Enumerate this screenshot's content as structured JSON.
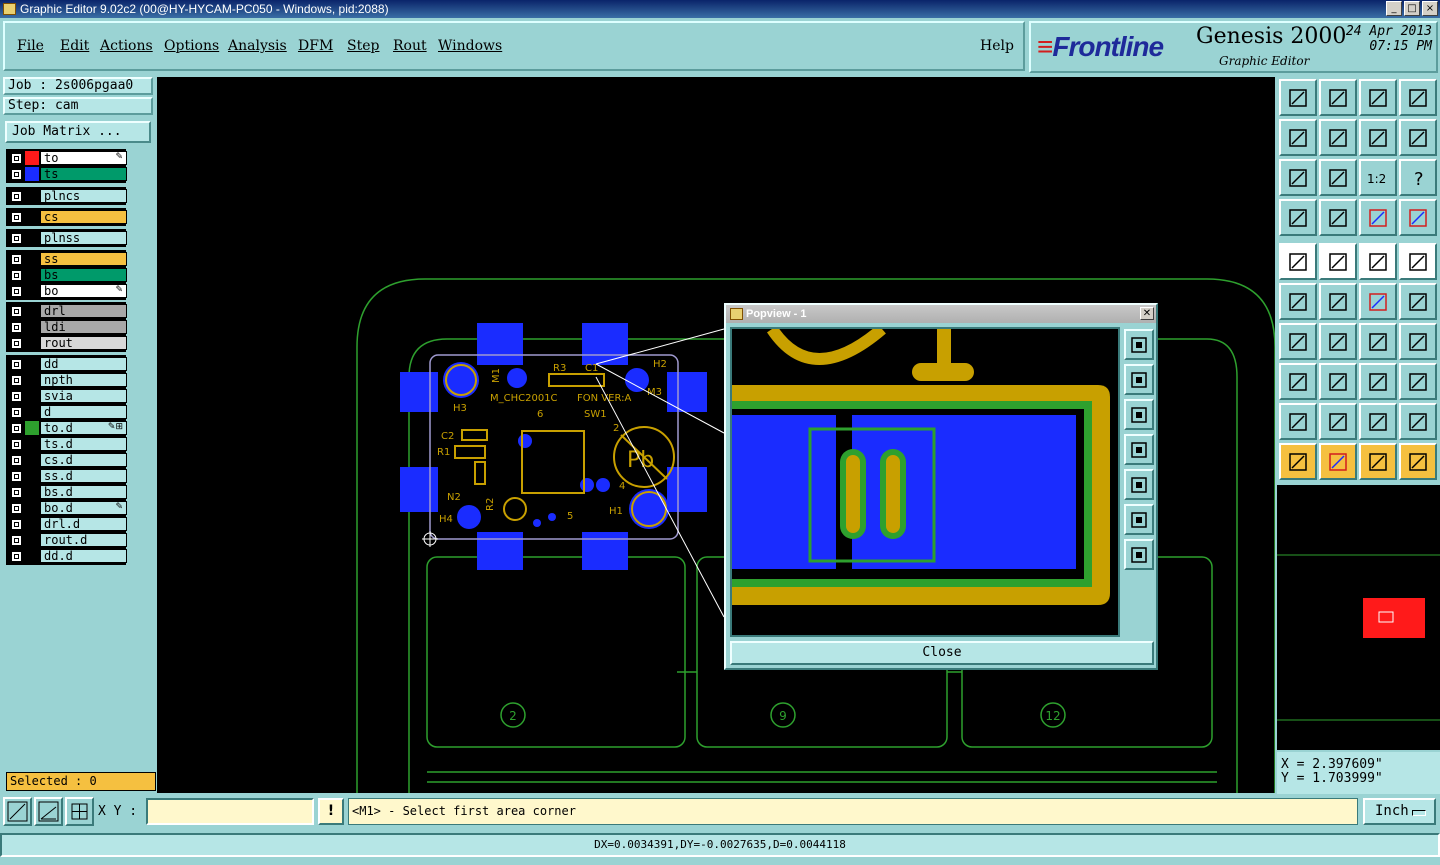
{
  "window": {
    "title": "Graphic Editor 9.02c2 (00@HY-HYCAM-PC050 - Windows, pid:2088)"
  },
  "menu": {
    "items": [
      "File",
      "Edit",
      "Actions",
      "Options",
      "Analysis",
      "DFM",
      "Step",
      "Rout",
      "Windows"
    ],
    "help": "Help"
  },
  "branding": {
    "logo": "Frontline",
    "product": "Genesis 2000",
    "subtitle": "Graphic Editor",
    "date": "24 Apr 2013",
    "time": "07:15 PM"
  },
  "job": {
    "job_label": "Job : 2s006pgaa0",
    "step_label": "Step: cam",
    "matrix_button": "Job Matrix ..."
  },
  "layers": [
    {
      "name": "to",
      "swatch": "#ff1a1a",
      "bg": "#ffffff",
      "icon": "✎"
    },
    {
      "name": "ts",
      "swatch": "#1a2cff",
      "bg": "#009a6a",
      "icon": ""
    },
    {
      "name": "plncs",
      "swatch": "#000000",
      "bg": "#b6e6e6",
      "icon": ""
    },
    {
      "name": "cs",
      "swatch": "#000000",
      "bg": "#f5c040",
      "icon": ""
    },
    {
      "name": "plnss",
      "swatch": "#000000",
      "bg": "#b6e6e6",
      "icon": ""
    },
    {
      "name": "ss",
      "swatch": "#000000",
      "bg": "#f5c040",
      "icon": ""
    },
    {
      "name": "bs",
      "swatch": "#000000",
      "bg": "#009a6a",
      "icon": ""
    },
    {
      "name": "bo",
      "swatch": "#000000",
      "bg": "#ffffff",
      "icon": "✎"
    },
    {
      "name": "drl",
      "swatch": "#000000",
      "bg": "#a8a8a8",
      "icon": ""
    },
    {
      "name": "ldi",
      "swatch": "#000000",
      "bg": "#a8a8a8",
      "icon": ""
    },
    {
      "name": "rout",
      "swatch": "#000000",
      "bg": "#d8d8d8",
      "icon": ""
    },
    {
      "name": "dd",
      "swatch": "#000000",
      "bg": "#b6e6e6",
      "icon": ""
    },
    {
      "name": "npth",
      "swatch": "#000000",
      "bg": "#b6e6e6",
      "icon": ""
    },
    {
      "name": "svia",
      "swatch": "#000000",
      "bg": "#b6e6e6",
      "icon": ""
    },
    {
      "name": "d",
      "swatch": "#000000",
      "bg": "#b6e6e6",
      "icon": ""
    },
    {
      "name": "to.d",
      "swatch": "#2ea02e",
      "bg": "#b6e6e6",
      "icon": "✎⊞"
    },
    {
      "name": "ts.d",
      "swatch": "#000000",
      "bg": "#b6e6e6",
      "icon": ""
    },
    {
      "name": "cs.d",
      "swatch": "#000000",
      "bg": "#b6e6e6",
      "icon": ""
    },
    {
      "name": "ss.d",
      "swatch": "#000000",
      "bg": "#b6e6e6",
      "icon": ""
    },
    {
      "name": "bs.d",
      "swatch": "#000000",
      "bg": "#b6e6e6",
      "icon": ""
    },
    {
      "name": "bo.d",
      "swatch": "#000000",
      "bg": "#b6e6e6",
      "icon": "✎"
    },
    {
      "name": "drl.d",
      "swatch": "#000000",
      "bg": "#b6e6e6",
      "icon": ""
    },
    {
      "name": "rout.d",
      "swatch": "#000000",
      "bg": "#b6e6e6",
      "icon": ""
    },
    {
      "name": "dd.d",
      "swatch": "#000000",
      "bg": "#b6e6e6",
      "icon": ""
    }
  ],
  "selected": "Selected : 0",
  "board": {
    "labels": [
      "H2",
      "R3",
      "C1",
      "M1",
      "H3",
      "M3",
      "M_CHC2001C",
      "FON VER:A",
      "SW1",
      "6",
      "C2",
      "R1",
      "2",
      "N2",
      "R2",
      "4",
      "H4",
      "5",
      "H1"
    ],
    "panel_numbers": [
      "2",
      "9",
      "12"
    ],
    "pb_mark": "Pb"
  },
  "popview": {
    "title": "Popview - 1",
    "close_label": "Close",
    "close_x": "✕"
  },
  "coords": {
    "x": "X = 2.397609\"",
    "y": "Y = 1.703999\""
  },
  "bottom": {
    "xy_label": "X Y :",
    "xy_value": "",
    "prompt": "<M1> - Select first area corner",
    "units": "Inch",
    "bang": "!"
  },
  "status": "DX=0.0034391,DY=-0.0027635,D=0.0044118",
  "toolbar_icons": [
    "zoom-home-icon",
    "zoom-area-icon",
    "home-icon",
    "window-icon",
    "zoom-in-icon",
    "zoom-out-icon",
    "pan-icon",
    "layer-toggle-icon",
    "fit-screen-icon",
    "center-icon",
    "scale-1-2-icon",
    "help-icon",
    "tools-icon",
    "grid-icon",
    "snap-red-icon",
    "snap-red2-icon",
    "select-icon",
    "vertex-icon",
    "ruler-icon",
    "point-icon",
    "connect-icon",
    "cross-icon",
    "line-red-icon",
    "line-arrow-icon",
    "angle-icon",
    "line-icon",
    "arc-icon",
    "split-icon",
    "shape-icon",
    "join-icon",
    "measure-icon",
    "group-icon",
    "triangle-icon",
    "triangle2-icon",
    "triangle3-icon",
    "triangle4-icon",
    "pointer-icon",
    "pointer-red-icon",
    "pointer-yellow-icon",
    "route-icon"
  ],
  "colors": {
    "bg": "#9ad3d3",
    "accent_orange": "#f5c040",
    "copper": "#c8a000",
    "pad_blue": "#1a2cff",
    "outline_green": "#2ea02e"
  }
}
